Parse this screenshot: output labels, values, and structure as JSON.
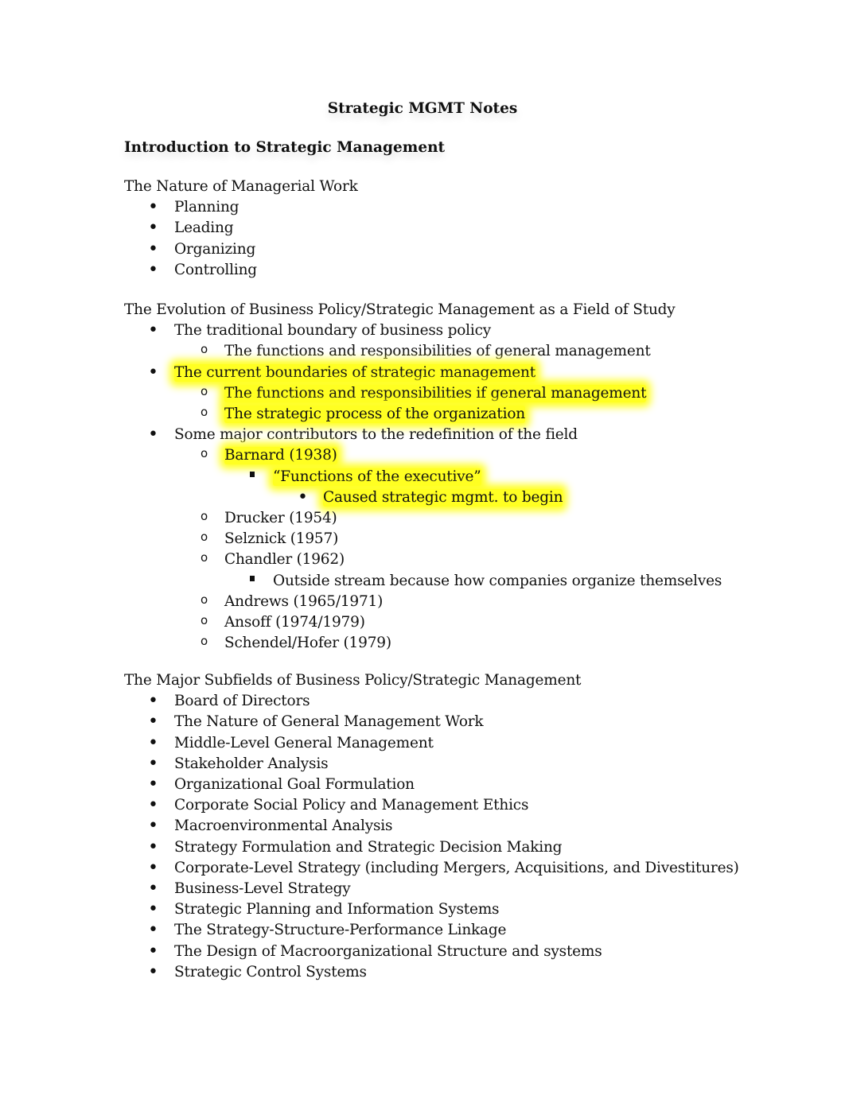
{
  "document": {
    "title": "Strategic MGMT Notes",
    "heading": "Introduction to Strategic Management",
    "highlight_color": "#ffff22",
    "sections": [
      {
        "title": "The Nature of Managerial Work",
        "items": [
          "Planning",
          "Leading",
          "Organizing",
          "Controlling"
        ]
      },
      {
        "title": "The Evolution of Business Policy/Strategic Management as a Field of Study",
        "items": [
          {
            "text": "The traditional boundary of business policy",
            "level": 1,
            "highlighted": false
          },
          {
            "text": "The functions and responsibilities of general management",
            "level": 2,
            "highlighted": false
          },
          {
            "text": "The current boundaries of strategic management",
            "level": 1,
            "highlighted": true
          },
          {
            "text": "The functions and responsibilities if general management",
            "level": 2,
            "highlighted": true
          },
          {
            "text": "The strategic process of the organization",
            "level": 2,
            "highlighted": true
          },
          {
            "text": "Some major contributors to the redefinition of the field",
            "level": 1,
            "highlighted": false
          },
          {
            "text": "Barnard (1938)",
            "level": 2,
            "highlighted": true
          },
          {
            "text": "“Functions of the executive”",
            "level": 3,
            "highlighted": true
          },
          {
            "text": "Caused strategic mgmt. to begin",
            "level": 4,
            "highlighted": true
          },
          {
            "text": "Drucker (1954)",
            "level": 2,
            "highlighted": false
          },
          {
            "text": "Selznick (1957)",
            "level": 2,
            "highlighted": false
          },
          {
            "text": "Chandler (1962)",
            "level": 2,
            "highlighted": false
          },
          {
            "text": "Outside stream because how companies organize themselves",
            "level": 3,
            "highlighted": false
          },
          {
            "text": "Andrews (1965/1971)",
            "level": 2,
            "highlighted": false
          },
          {
            "text": "Ansoff (1974/1979)",
            "level": 2,
            "highlighted": false
          },
          {
            "text": "Schendel/Hofer (1979)",
            "level": 2,
            "highlighted": false
          }
        ]
      },
      {
        "title": "The Major Subfields of Business Policy/Strategic Management",
        "items": [
          "Board of Directors",
          "The Nature of General Management Work",
          "Middle-Level General Management",
          "Stakeholder Analysis",
          "Organizational Goal Formulation",
          "Corporate Social Policy and Management Ethics",
          "Macroenvironmental Analysis",
          "Strategy Formulation and Strategic Decision Making",
          "Corporate-Level Strategy (including Mergers, Acquisitions, and Divestitures)",
          "Business-Level Strategy",
          "Strategic Planning and Information Systems",
          "The Strategy-Structure-Performance Linkage",
          "The Design of Macroorganizational Structure and systems",
          "Strategic Control Systems"
        ]
      }
    ]
  }
}
